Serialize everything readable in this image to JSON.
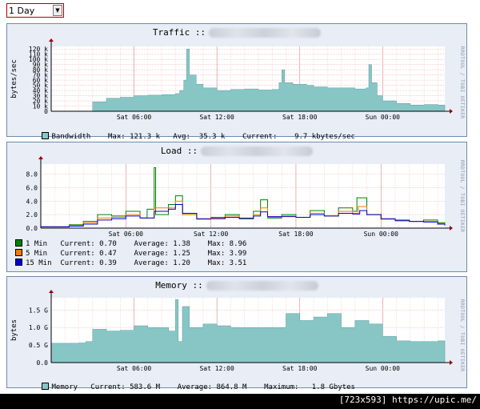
{
  "range_select": {
    "value": "1 Day",
    "options": [
      "1 Day"
    ]
  },
  "footer": {
    "text": "[723x593] https://upic.me/"
  },
  "vendor_label": "RRDTOOL / TOBI OETIKER",
  "colors": {
    "traffic_fill": "#88c6c6",
    "grid": "#f3b3b3",
    "one_min": "#008000",
    "five_min": "#ff7700",
    "fifteen_min": "#0000cc"
  },
  "traffic": {
    "title": "Traffic ::",
    "ylabel": "bytes/sec",
    "legend": {
      "name": "Bandwidth",
      "max_label": "Max:",
      "max": "121.3 k",
      "avg_label": "Avg:",
      "avg": "35.3 k",
      "cur_label": "Current:",
      "cur": "9.7 kbytes/sec"
    }
  },
  "load": {
    "title": "Load ::",
    "legend": [
      {
        "name": "1 Min",
        "current": "0.70",
        "average": "1.38",
        "max": "8.96"
      },
      {
        "name": "5 Min",
        "current": "0.47",
        "average": "1.25",
        "max": "3.99"
      },
      {
        "name": "15 Min",
        "current": "0.39",
        "average": "1.20",
        "max": "3.51"
      }
    ],
    "labels": {
      "current": "Current:",
      "average": "Average:",
      "max": "Max:"
    }
  },
  "memory": {
    "title": "Memory ::",
    "ylabel": "bytes",
    "legend": {
      "name": "Memory",
      "cur_label": "Current:",
      "cur": "583.6 M",
      "avg_label": "Average:",
      "avg": "864.8 M",
      "max_label": "Maximum:",
      "max": "1.8 Gbytes"
    }
  },
  "chart_data": [
    {
      "type": "area",
      "title": "Traffic ::",
      "ylabel": "bytes/sec",
      "y_ticks": [
        "0",
        "10 k",
        "20 k",
        "30 k",
        "40 k",
        "50 k",
        "60 k",
        "70 k",
        "80 k",
        "90 k",
        "100 k",
        "110 k",
        "120 k"
      ],
      "x_ticks": [
        "Sat 06:00",
        "Sat 12:00",
        "Sat 18:00",
        "Sun 00:00"
      ],
      "ylim": [
        0,
        125000
      ],
      "x_hours": [
        0,
        6,
        12,
        18,
        24
      ],
      "series": [
        {
          "name": "Bandwidth",
          "points": [
            [
              2.5,
              0
            ],
            [
              3.0,
              18000
            ],
            [
              4.0,
              25000
            ],
            [
              5.0,
              27000
            ],
            [
              6.0,
              30000
            ],
            [
              7.0,
              31000
            ],
            [
              8.0,
              32000
            ],
            [
              9.0,
              34000
            ],
            [
              9.3,
              40000
            ],
            [
              9.6,
              60000
            ],
            [
              9.8,
              120000
            ],
            [
              10.0,
              70000
            ],
            [
              10.5,
              52000
            ],
            [
              11.0,
              45000
            ],
            [
              12.0,
              40000
            ],
            [
              13.0,
              42000
            ],
            [
              14.0,
              43000
            ],
            [
              15.0,
              41000
            ],
            [
              16.0,
              42000
            ],
            [
              16.5,
              55000
            ],
            [
              16.7,
              80000
            ],
            [
              16.9,
              55000
            ],
            [
              17.5,
              52000
            ],
            [
              18.5,
              50000
            ],
            [
              19.0,
              47000
            ],
            [
              20.0,
              45000
            ],
            [
              21.0,
              45000
            ],
            [
              22.0,
              43000
            ],
            [
              22.8,
              45000
            ],
            [
              23.0,
              90000
            ],
            [
              23.2,
              55000
            ],
            [
              23.6,
              30000
            ],
            [
              24.0,
              20000
            ],
            [
              25.0,
              15000
            ],
            [
              26.0,
              12000
            ],
            [
              27.0,
              13000
            ],
            [
              28.0,
              12000
            ],
            [
              28.5,
              9700
            ]
          ]
        }
      ]
    },
    {
      "type": "line",
      "title": "Load ::",
      "y_ticks": [
        "0.0",
        "2.0",
        "4.0",
        "6.0",
        "8.0"
      ],
      "x_ticks": [
        "Sat 06:00",
        "Sat 12:00",
        "Sat 18:00",
        "Sun 00:00"
      ],
      "ylim": [
        0,
        9.5
      ],
      "x_hours": [
        0,
        6,
        12,
        18,
        24
      ],
      "series": [
        {
          "name": "1 Min",
          "points": [
            [
              0,
              0.2
            ],
            [
              2,
              0.5
            ],
            [
              3,
              1.0
            ],
            [
              4,
              2.0
            ],
            [
              5,
              1.8
            ],
            [
              6,
              2.5
            ],
            [
              7,
              1.5
            ],
            [
              7.5,
              2.8
            ],
            [
              8.0,
              8.96
            ],
            [
              8.1,
              2.0
            ],
            [
              9,
              3.5
            ],
            [
              9.5,
              4.8
            ],
            [
              10,
              2.0
            ],
            [
              11,
              1.3
            ],
            [
              12,
              1.6
            ],
            [
              13,
              2.0
            ],
            [
              14,
              1.5
            ],
            [
              15,
              2.5
            ],
            [
              15.5,
              4.2
            ],
            [
              16,
              1.5
            ],
            [
              17,
              2.0
            ],
            [
              18,
              1.6
            ],
            [
              19,
              2.6
            ],
            [
              20,
              1.8
            ],
            [
              21,
              3.0
            ],
            [
              22,
              2.5
            ],
            [
              22.3,
              4.5
            ],
            [
              23,
              2.0
            ],
            [
              24,
              1.3
            ],
            [
              25,
              1.2
            ],
            [
              26,
              1.0
            ],
            [
              27,
              1.2
            ],
            [
              28,
              0.8
            ],
            [
              28.5,
              0.7
            ]
          ]
        },
        {
          "name": "5 Min",
          "points": [
            [
              0,
              0.2
            ],
            [
              2,
              0.4
            ],
            [
              3,
              0.8
            ],
            [
              4,
              1.5
            ],
            [
              5,
              1.6
            ],
            [
              6,
              2.0
            ],
            [
              7,
              1.5
            ],
            [
              8,
              3.0
            ],
            [
              9,
              3.0
            ],
            [
              9.5,
              3.99
            ],
            [
              10,
              2.0
            ],
            [
              11,
              1.3
            ],
            [
              12,
              1.5
            ],
            [
              13,
              1.8
            ],
            [
              14,
              1.4
            ],
            [
              15,
              2.0
            ],
            [
              15.5,
              3.0
            ],
            [
              16,
              1.6
            ],
            [
              17,
              1.8
            ],
            [
              18,
              1.6
            ],
            [
              19,
              2.2
            ],
            [
              20,
              1.8
            ],
            [
              21,
              2.5
            ],
            [
              22,
              2.2
            ],
            [
              22.4,
              3.2
            ],
            [
              23,
              2.0
            ],
            [
              24,
              1.3
            ],
            [
              25,
              1.1
            ],
            [
              26,
              1.0
            ],
            [
              27,
              1.0
            ],
            [
              28,
              0.7
            ],
            [
              28.5,
              0.47
            ]
          ]
        },
        {
          "name": "15 Min",
          "points": [
            [
              0,
              0.2
            ],
            [
              2,
              0.3
            ],
            [
              3,
              0.6
            ],
            [
              4,
              1.2
            ],
            [
              5,
              1.4
            ],
            [
              6,
              1.8
            ],
            [
              7,
              1.5
            ],
            [
              8,
              2.5
            ],
            [
              9,
              2.8
            ],
            [
              9.5,
              3.51
            ],
            [
              10,
              2.2
            ],
            [
              11,
              1.4
            ],
            [
              12,
              1.4
            ],
            [
              13,
              1.6
            ],
            [
              14,
              1.4
            ],
            [
              15,
              1.8
            ],
            [
              15.5,
              2.4
            ],
            [
              16,
              1.7
            ],
            [
              17,
              1.7
            ],
            [
              18,
              1.6
            ],
            [
              19,
              2.0
            ],
            [
              20,
              1.8
            ],
            [
              21,
              2.2
            ],
            [
              22,
              2.1
            ],
            [
              22.5,
              2.6
            ],
            [
              23,
              2.0
            ],
            [
              24,
              1.4
            ],
            [
              25,
              1.1
            ],
            [
              26,
              1.0
            ],
            [
              27,
              0.9
            ],
            [
              28,
              0.6
            ],
            [
              28.5,
              0.39
            ]
          ]
        }
      ]
    },
    {
      "type": "area",
      "title": "Memory ::",
      "ylabel": "bytes",
      "y_ticks": [
        "0.0",
        "0.5 G",
        "1.0 G",
        "1.5 G"
      ],
      "x_ticks": [
        "Sat 06:00",
        "Sat 12:00",
        "Sat 18:00",
        "Sun 00:00"
      ],
      "ylim": [
        0,
        1.85
      ],
      "x_hours": [
        0,
        6,
        12,
        18,
        24
      ],
      "series": [
        {
          "name": "Memory",
          "points": [
            [
              0,
              0.55
            ],
            [
              2,
              0.56
            ],
            [
              2.5,
              0.6
            ],
            [
              3,
              0.95
            ],
            [
              4,
              0.9
            ],
            [
              5,
              0.92
            ],
            [
              6,
              1.05
            ],
            [
              7,
              1.0
            ],
            [
              8,
              1.0
            ],
            [
              8.5,
              0.9
            ],
            [
              9,
              1.8
            ],
            [
              9.2,
              0.6
            ],
            [
              9.5,
              1.6
            ],
            [
              10,
              1.0
            ],
            [
              11,
              1.1
            ],
            [
              12,
              1.05
            ],
            [
              13,
              1.0
            ],
            [
              14,
              1.0
            ],
            [
              15,
              1.0
            ],
            [
              16,
              1.0
            ],
            [
              17,
              1.4
            ],
            [
              18,
              1.2
            ],
            [
              19,
              1.3
            ],
            [
              20,
              1.4
            ],
            [
              21,
              1.0
            ],
            [
              22,
              1.2
            ],
            [
              23,
              1.1
            ],
            [
              24,
              0.75
            ],
            [
              25,
              0.62
            ],
            [
              26,
              0.6
            ],
            [
              27,
              0.6
            ],
            [
              28,
              0.62
            ],
            [
              28.5,
              0.58
            ]
          ]
        }
      ]
    }
  ]
}
